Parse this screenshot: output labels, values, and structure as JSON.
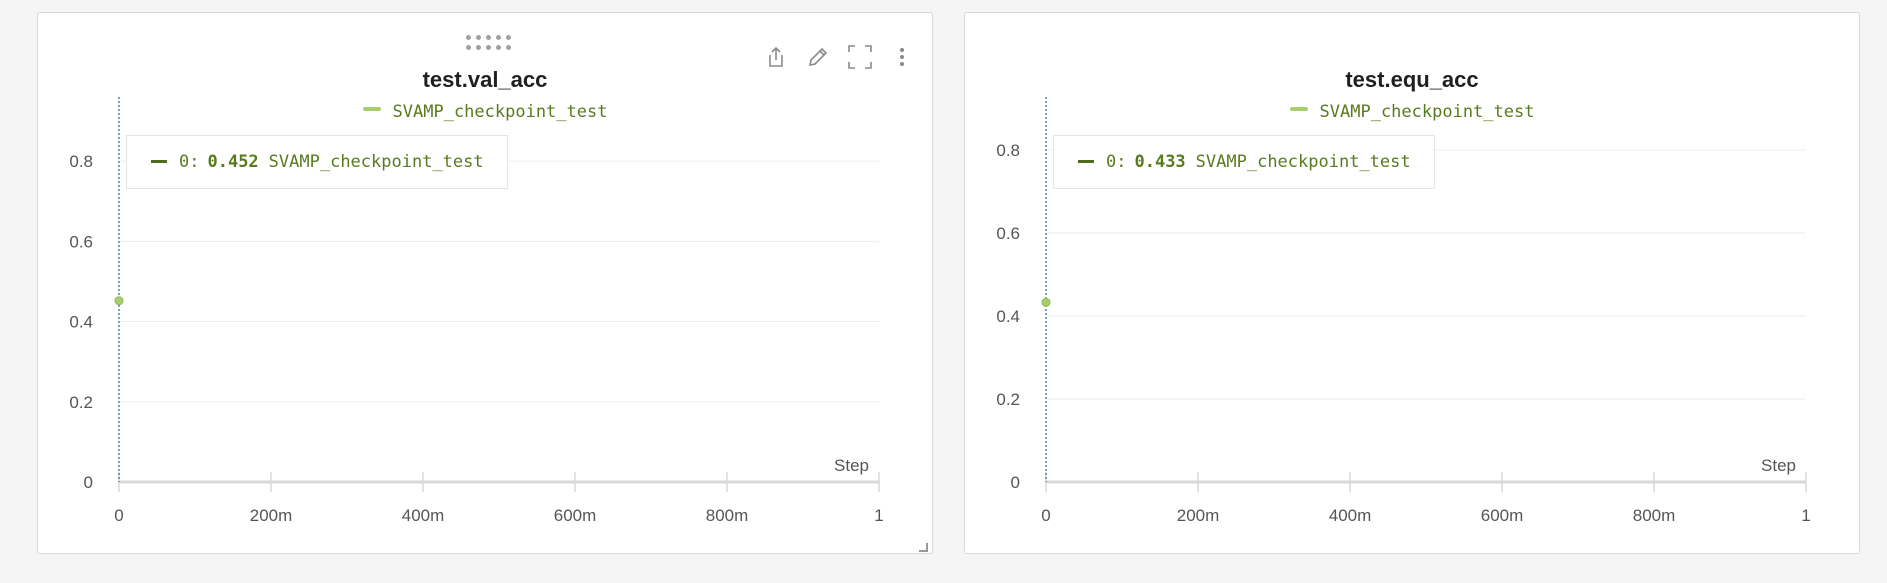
{
  "colors": {
    "series": "#a6cf6b",
    "series_dark": "#5a7a1e",
    "grid": "#ececec",
    "axis": "#d8d8d8",
    "tick_text": "#555555",
    "cursor_line": "#4a7bd0"
  },
  "toolbar": {
    "icons": [
      "share-icon",
      "edit-icon",
      "fullscreen-icon",
      "more-icon"
    ]
  },
  "panels": [
    {
      "title": "test.val_acc",
      "legend": "SVAMP_checkpoint_test",
      "tooltip": {
        "prefix": "0:",
        "value": "0.452",
        "series": "SVAMP_checkpoint_test"
      },
      "axis_label_x": "Step",
      "y_ticks": [
        "0",
        "0.2",
        "0.4",
        "0.6",
        "0.8"
      ],
      "x_ticks": [
        "0",
        "200m",
        "400m",
        "600m",
        "800m",
        "1"
      ]
    },
    {
      "title": "test.equ_acc",
      "legend": "SVAMP_checkpoint_test",
      "tooltip": {
        "prefix": "0:",
        "value": "0.433",
        "series": "SVAMP_checkpoint_test"
      },
      "axis_label_x": "Step",
      "y_ticks": [
        "0",
        "0.2",
        "0.4",
        "0.6",
        "0.8"
      ],
      "x_ticks": [
        "0",
        "200m",
        "400m",
        "600m",
        "800m",
        "1"
      ]
    }
  ],
  "chart_data": [
    {
      "type": "line",
      "title": "test.val_acc",
      "xlabel": "Step",
      "ylabel": "",
      "xlim": [
        0,
        1
      ],
      "ylim": [
        0,
        0.9
      ],
      "x_tick_values": [
        0,
        0.2,
        0.4,
        0.6,
        0.8,
        1
      ],
      "y_tick_values": [
        0,
        0.2,
        0.4,
        0.6,
        0.8
      ],
      "grid": true,
      "legend_position": "top-center",
      "series": [
        {
          "name": "SVAMP_checkpoint_test",
          "x": [
            0
          ],
          "y": [
            0.452
          ]
        }
      ]
    },
    {
      "type": "line",
      "title": "test.equ_acc",
      "xlabel": "Step",
      "ylabel": "",
      "xlim": [
        0,
        1
      ],
      "ylim": [
        0,
        0.87
      ],
      "x_tick_values": [
        0,
        0.2,
        0.4,
        0.6,
        0.8,
        1
      ],
      "y_tick_values": [
        0,
        0.2,
        0.4,
        0.6,
        0.8
      ],
      "grid": true,
      "legend_position": "top-center",
      "series": [
        {
          "name": "SVAMP_checkpoint_test",
          "x": [
            0
          ],
          "y": [
            0.433
          ]
        }
      ]
    }
  ]
}
